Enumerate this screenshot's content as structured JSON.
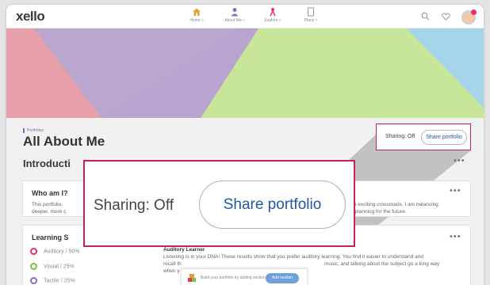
{
  "nav": {
    "logo": "xello",
    "items": [
      {
        "label": "Home",
        "icon": "home-icon"
      },
      {
        "label": "About Me",
        "icon": "person-icon"
      },
      {
        "label": "Explore",
        "icon": "explore-icon"
      },
      {
        "label": "Plans",
        "icon": "plans-icon"
      }
    ],
    "search_icon": "search-icon",
    "heart_icon": "heart-icon",
    "avatar_icon": "avatar-icon"
  },
  "banner": {
    "colors": [
      "#e7a0a9",
      "#bba6cf",
      "#c7e69a",
      "#a6d4e8"
    ]
  },
  "page": {
    "breadcrumb": "Portfolios",
    "title": "All About Me",
    "section_title": "Introducti"
  },
  "share": {
    "status_label": "Sharing: Off",
    "button_label": "Share portfolio",
    "zoom_status_label": "Sharing: Off",
    "zoom_button_label": "Share portfolio",
    "accent": "#c9234d"
  },
  "who_card": {
    "title": "Who am I?",
    "line1_left": "This portfolio,",
    "line1_right": "at an exciting crossroads. I am balancing",
    "line2_left": "deeper, more c",
    "line2_right": "and planning for the future."
  },
  "learning_card": {
    "title": "Learning S",
    "styles": [
      {
        "label": "Auditory / 50%",
        "color": "#e8315e"
      },
      {
        "label": "Visual / 25%",
        "color": "#7cc242"
      },
      {
        "label": "Tactile / 25%",
        "color": "#8a6ac6"
      }
    ],
    "detail_title": "Auditory Learner",
    "detail_line1": "Listening is in your DNA! These results show that you prefer auditory learning. You find it easier to understand and",
    "detail_line2_left": "recall th",
    "detail_line2_right": "music, and talking about the subject go a long way",
    "detail_line3": "when y"
  },
  "toast": {
    "text": "Build your portfolio by adding sections.",
    "button": "Add section"
  },
  "more_icon": "more-dots-icon"
}
